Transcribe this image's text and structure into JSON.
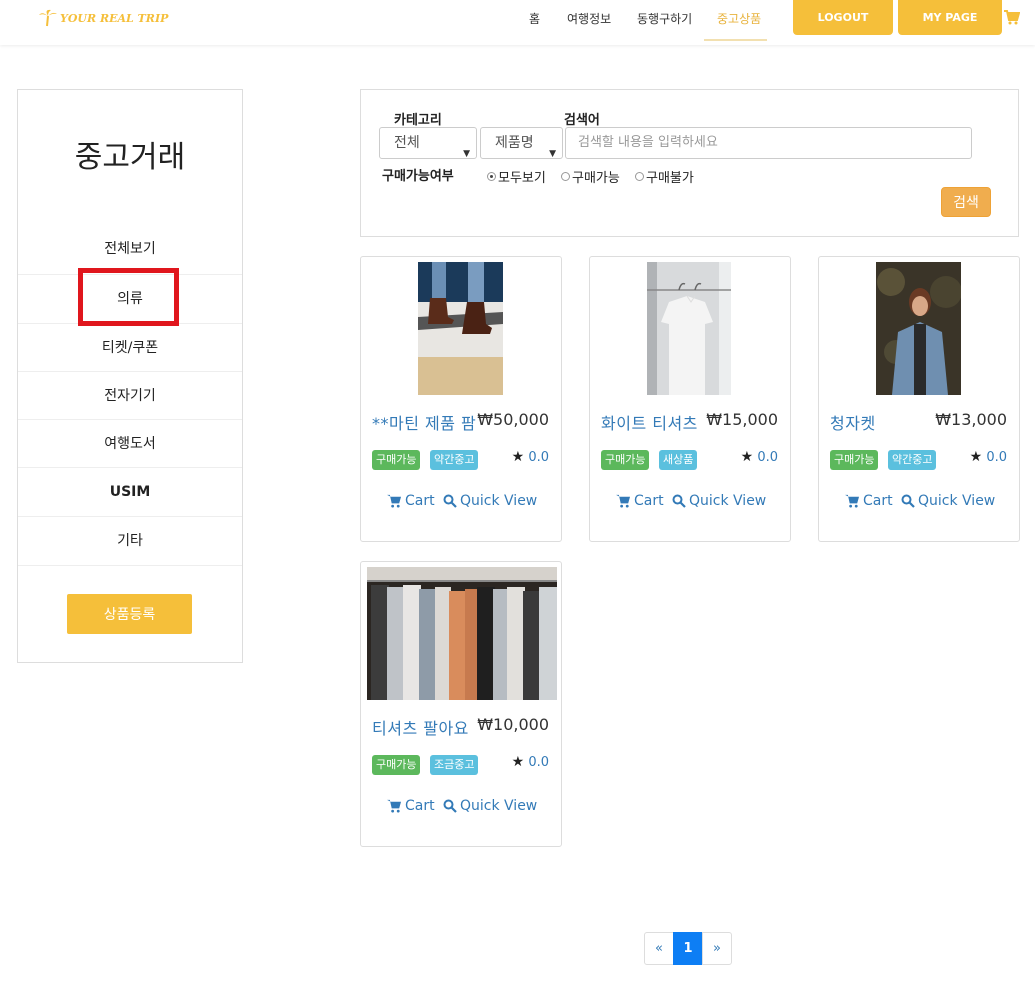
{
  "nav": {
    "logo": "YOUR REAL TRIP",
    "links": [
      "홈",
      "여행정보",
      "동행구하기",
      "중고상품"
    ],
    "active_link": "중고상품",
    "logout": "LOGOUT",
    "mypage": "MY PAGE"
  },
  "sidebar": {
    "title": "중고거래",
    "items": [
      {
        "label": "전체보기"
      },
      {
        "label": "의류"
      },
      {
        "label": "티켓/쿠폰"
      },
      {
        "label": "전자기기"
      },
      {
        "label": "여행도서"
      },
      {
        "label": "USIM"
      },
      {
        "label": "기타"
      }
    ],
    "selected": "의류",
    "register_button": "상품등록"
  },
  "search": {
    "category_label": "카테고리",
    "keyword_label": "검색어",
    "category_value": "전체",
    "field_value": "제품명",
    "keyword_placeholder": "검색할 내용을 입력하세요",
    "availability_label": "구매가능여부",
    "options": [
      "모두보기",
      "구매가능",
      "구매불가"
    ],
    "selected_option": "모두보기",
    "search_button": "검색"
  },
  "products": [
    {
      "name": "**마틴 제품 팜",
      "price": "₩50,000",
      "status": "구매가능",
      "condition": "약간중고",
      "rating": "0.0"
    },
    {
      "name": "화이트 티셔츠",
      "price": "₩15,000",
      "status": "구매가능",
      "condition": "새상품",
      "rating": "0.0"
    },
    {
      "name": "청자켓",
      "price": "₩13,000",
      "status": "구매가능",
      "condition": "약간중고",
      "rating": "0.0"
    },
    {
      "name": "티셔츠 팔아요",
      "price": "₩10,000",
      "status": "구매가능",
      "condition": "조금중고",
      "rating": "0.0"
    }
  ],
  "card_actions": {
    "cart": "Cart",
    "quick_view": "Quick View"
  },
  "pagination": {
    "prev": "«",
    "current": "1",
    "next": "»"
  },
  "colors": {
    "accent": "#f5bf3a",
    "link": "#337ab7",
    "badge_green": "#5cb85c",
    "badge_blue": "#5bc0de",
    "highlight": "#e0161d",
    "page_active": "#0d7ef4"
  }
}
